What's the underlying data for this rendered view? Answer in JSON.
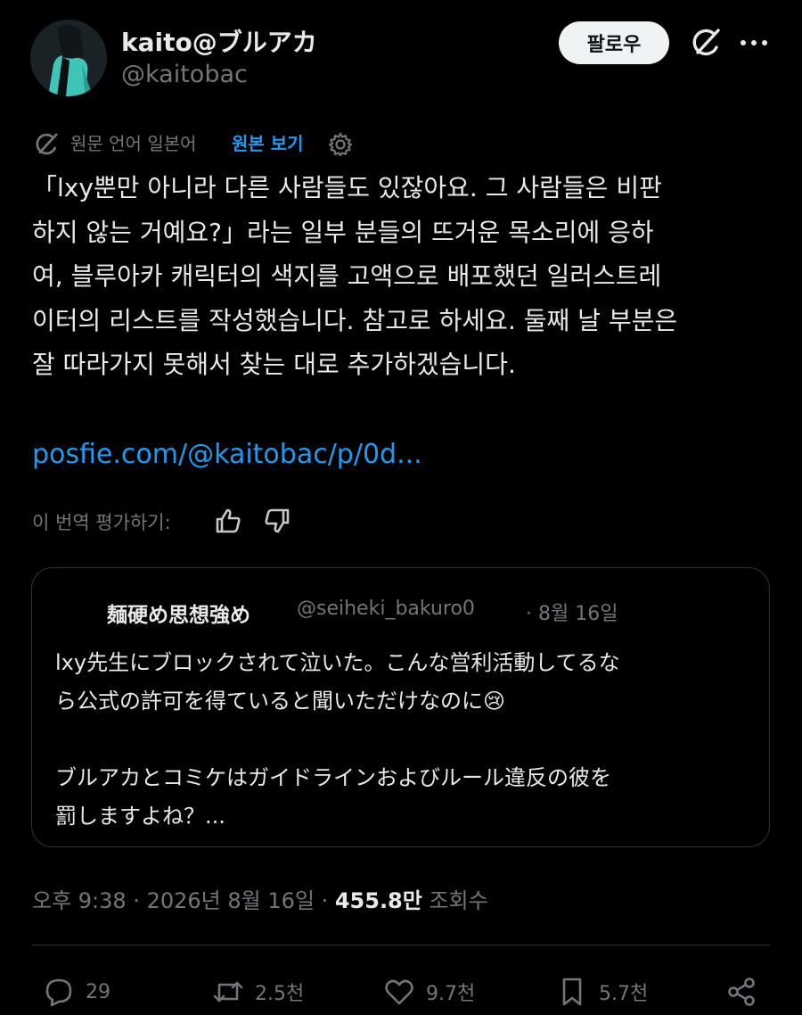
{
  "author": {
    "display_name": "kaito@ブルアカ",
    "handle": "@kaitobac",
    "follow_label": "팔로우"
  },
  "translation": {
    "label": "원문 언어 일본어",
    "show_original": "원본 보기"
  },
  "tweet": {
    "text": "「lxy뿐만 아니라 다른 사람들도 있잖아요. 그 사람들은 비판\n하지 않는 거예요?」라는 일부 분들의 뜨거운 목소리에 응하\n여, 블루아카 캐릭터의 색지를 고액으로 배포했던 일러스트레\n이터의 리스트를 작성했습니다. 참고로 하세요. 둘째 날 부분은\n잘 따라가지 못해서 찾는 대로 추가하겠습니다.",
    "link": "posfie.com/@kaitobac/p/0d..."
  },
  "rate": {
    "label": "이 번역 평가하기:"
  },
  "quote": {
    "name": "麺硬め思想強め",
    "handle": "@seiheki_bakuro0",
    "date": "· 8월 16일",
    "text": "lxy先生にブロックされて泣いた。こんな営利活動してるな\nら公式の許可を得ていると聞いただけなのに😢\n\nブルアカとコミケはガイドラインおよびルール違反の彼を\n罰しますよね？..."
  },
  "meta": {
    "time": "오후 9:38 · 2026년 8월 16일 · ",
    "views": "455.8만",
    "views_label": " 조회수"
  },
  "actions": {
    "replies": "29",
    "reposts": "2.5천",
    "likes": "9.7천",
    "bookmarks": "5.7천"
  },
  "colors": {
    "background": "#000000",
    "text": "#e7e9ea",
    "muted": "#71767b",
    "link": "#1d9bf0",
    "border": "#2f3336"
  }
}
